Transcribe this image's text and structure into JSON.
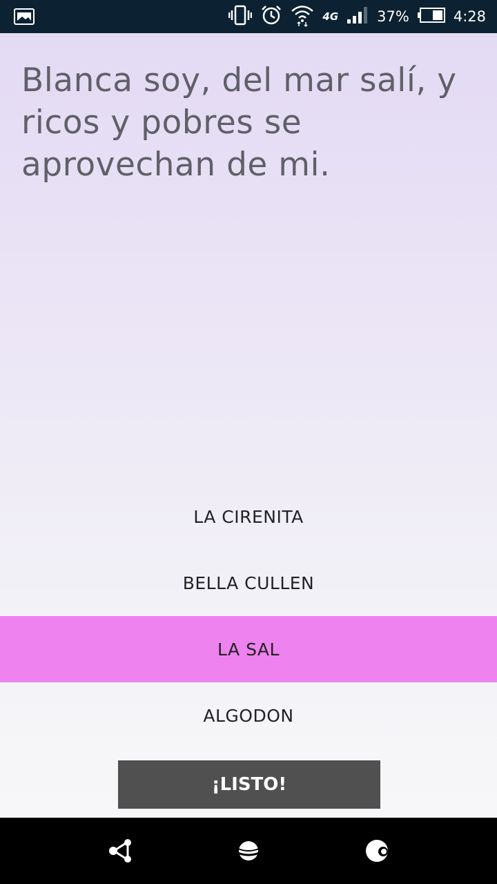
{
  "status_bar": {
    "battery_percent": "37%",
    "network": "4G",
    "time": "4:28",
    "icons": [
      "image-notification-icon",
      "vibrate-icon",
      "alarm-icon",
      "wifi-icon",
      "signal-icon",
      "battery-icon"
    ]
  },
  "quiz": {
    "question": "Blanca soy, del mar salí, y ricos y pobres se aprovechan de mi.",
    "options": [
      "LA CIRENITA",
      "BELLA CULLEN",
      "LA SAL",
      "ALGODON"
    ],
    "selected_index": 2,
    "submit_label": "¡LISTO!"
  },
  "colors": {
    "status_bar": "#0c2232",
    "selected_option": "#ee82ee",
    "submit_button": "#505050",
    "question_text": "#606068",
    "nav_bar": "#000000"
  },
  "nav_bar": {
    "icons": [
      "share-icon",
      "planet-icon",
      "moon-icon"
    ]
  }
}
